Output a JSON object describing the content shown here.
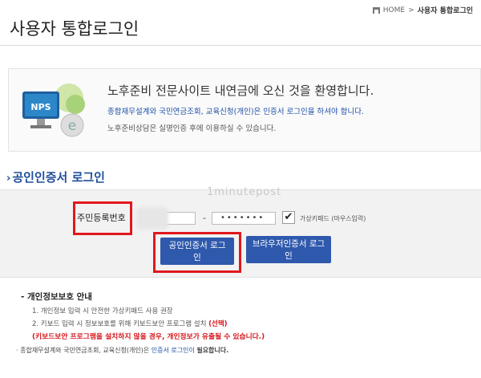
{
  "breadcrumb": {
    "home": "HOME",
    "sep": ">",
    "current": "사용자 통합로그인"
  },
  "page_title": "사용자 통합로그인",
  "welcome": {
    "logo_text": "NPS",
    "title": "노후준비 전문사이트 내연금에 오신 것을 환영합니다.",
    "line1": "종합재무설계와 국민연금조회, 교육신청(개인)은 인증서 로그인을 하셔야 합니다.",
    "line2": "노후준비상담은 실명인증 후에 이용하실 수 있습니다."
  },
  "section_title": "공인인증서 로그인",
  "watermark": "1minutepost",
  "login_form": {
    "rrn_label": "주민등록번호",
    "rrn_front_value": "",
    "rrn_dash": "-",
    "rrn_back_value": "•••••••",
    "virtual_keypad_label": "가상키패드 (마우스입력)",
    "virtual_keypad_checked": true,
    "cert_login_button": "공인인증서 로그인",
    "browser_cert_button": "브라우저인증서 로그인"
  },
  "privacy": {
    "title": "개인정보보호 안내",
    "item1": "1. 개인정보 입력 시 안전한 가상키패드 사용 권장",
    "item2": "2. 키보드 입력 시 정보보호를 위해 키보드보안 프로그램 설치",
    "item2_note": "(선택)",
    "warning": "(키보드보안 프로그램을 설치하지 않을 경우, 개인정보가 유출될 수 있습니다.)"
  },
  "footer": {
    "text": "종합재무설계와 국민연금조회, 교육신청(개인)은",
    "highlight": "인증서 로그인이",
    "tail": "필요합니다."
  },
  "colors": {
    "accent": "#2f59ad",
    "highlight_red": "#e0181e",
    "link_blue": "#1d4fa8"
  }
}
